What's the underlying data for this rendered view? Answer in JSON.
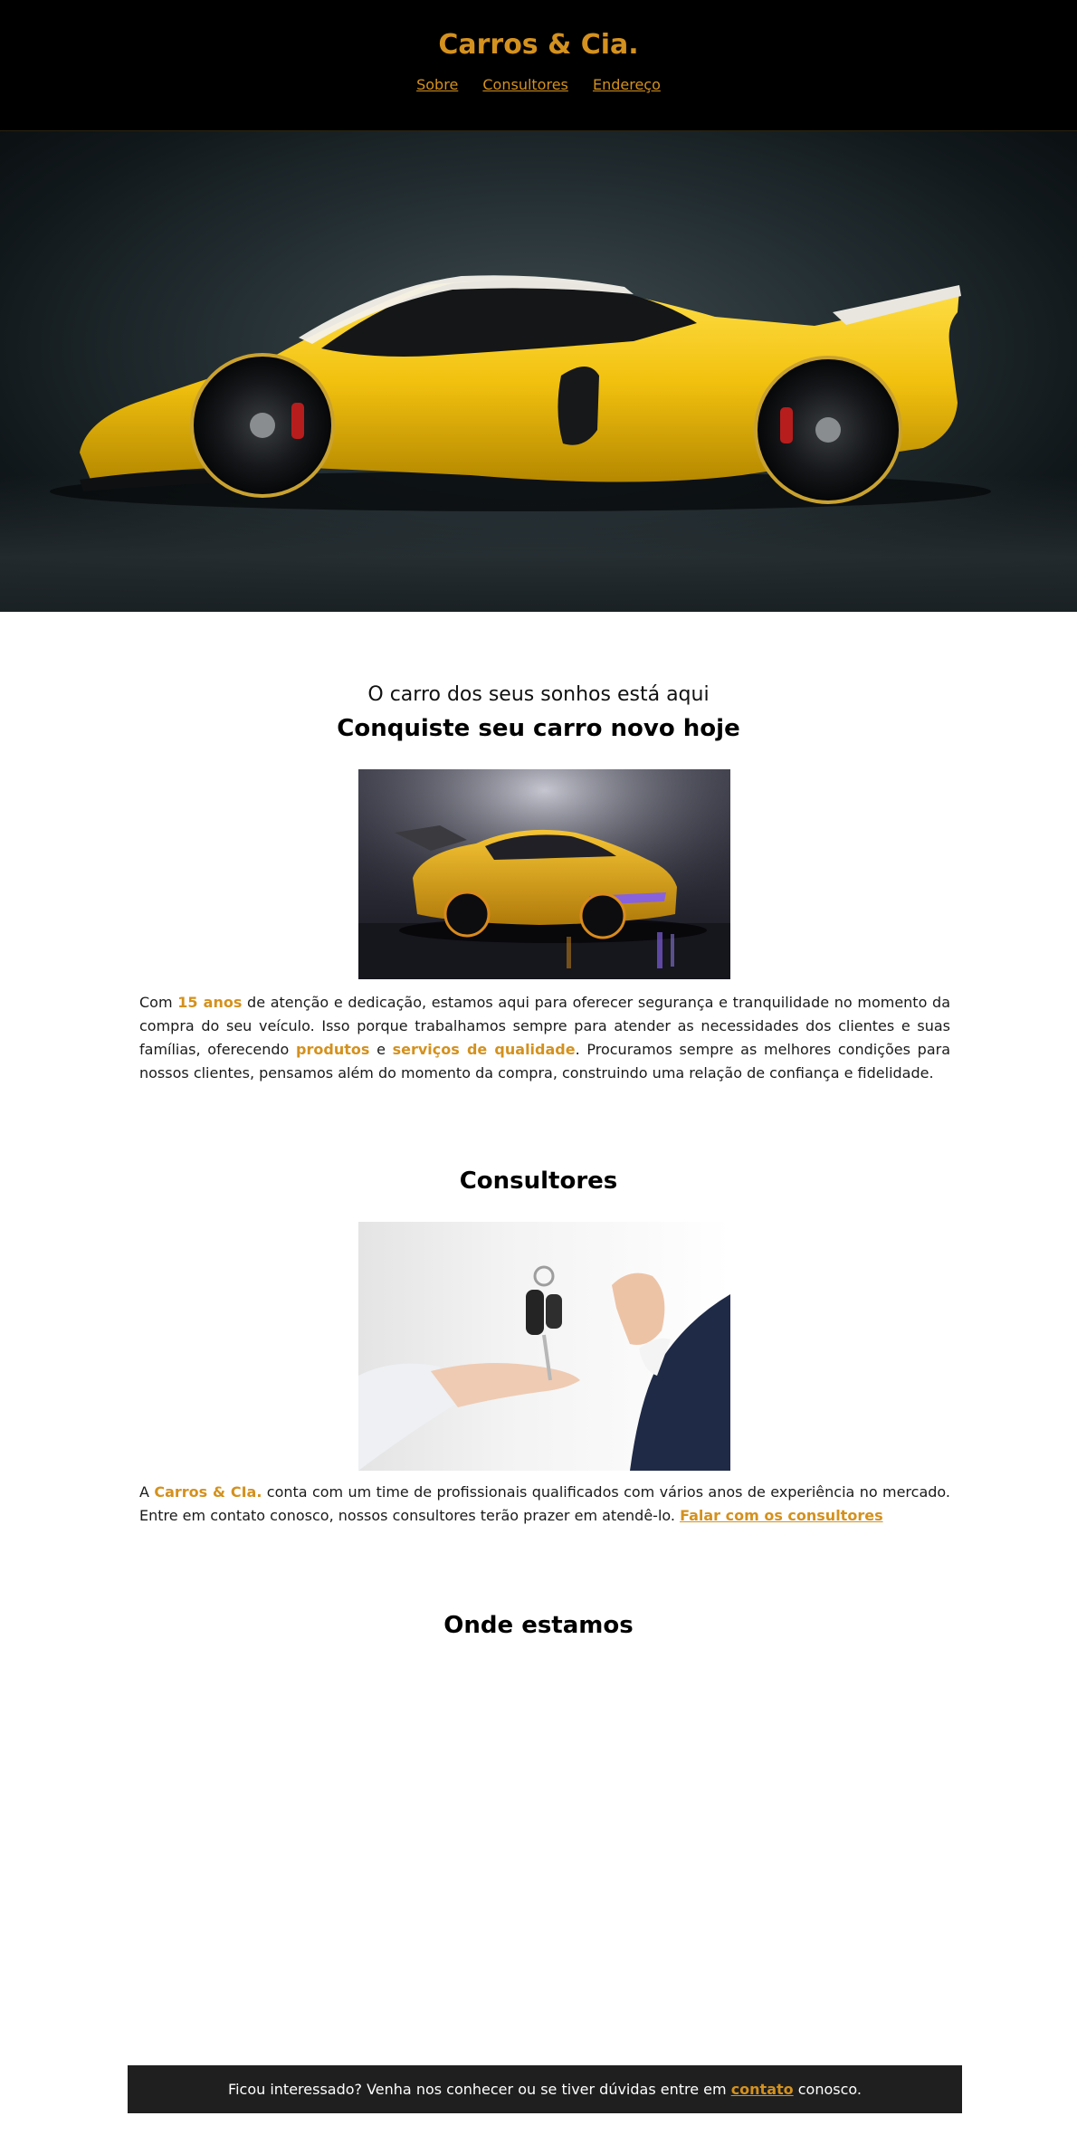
{
  "header": {
    "brand": "Carros & Cia.",
    "nav": [
      "Sobre",
      "Consultores",
      "Endereço"
    ]
  },
  "hero": {
    "image": "yellow-hypercar-photo"
  },
  "intro": {
    "tagline": "O carro dos seus sonhos está aqui",
    "heading": "Conquiste seu carro novo hoje",
    "image": "yellow-sports-car-photo",
    "text_parts": [
      "Com ",
      "15 anos",
      " de atenção e dedicação, estamos aqui para oferecer segurança e tranquilidade no momento da compra do seu veículo. Isso porque trabalhamos sempre para atender as necessidades dos clientes e suas famílias, oferecendo ",
      "produtos",
      " e ",
      "serviços de qualidade",
      ". Procuramos sempre as melhores condições para nossos clientes, pensamos além do momento da compra, construindo uma relação de confiança e fidelidade."
    ]
  },
  "consultores": {
    "heading": "Consultores",
    "image": "car-keys-handover-photo",
    "text_parts": [
      "A ",
      "Carros & CIa.",
      " conta com um time de profissionais qualificados com vários anos de experiência no mercado. Entre em contato conosco, nossos consultores terão prazer em atendê-lo. "
    ],
    "link_label": "Falar com os consultores"
  },
  "location": {
    "heading": "Onde estamos"
  },
  "footer": {
    "text_before": "Ficou interessado? Venha nos conhecer ou se tiver dúvidas entre em ",
    "link_label": "contato",
    "text_after": " conosco."
  },
  "colors": {
    "accent": "#d4911e",
    "header_bg": "#000000",
    "footer_bg": "#1f1f1f"
  }
}
